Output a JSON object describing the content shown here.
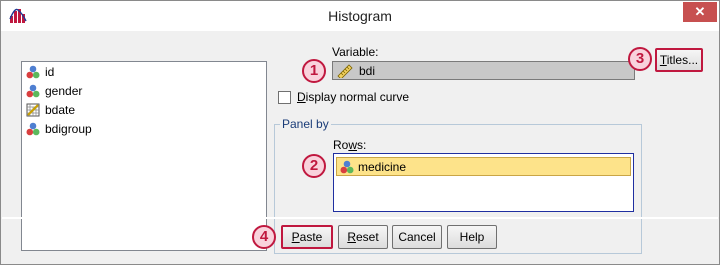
{
  "window": {
    "title": "Histogram",
    "close_glyph": "✕"
  },
  "variables": [
    {
      "name": "id",
      "icon": "nominal-icon"
    },
    {
      "name": "gender",
      "icon": "nominal-icon"
    },
    {
      "name": "bdate",
      "icon": "date-scale-icon"
    },
    {
      "name": "bdigroup",
      "icon": "nominal-icon"
    }
  ],
  "variable_field": {
    "label": "Variable:",
    "value": "bdi",
    "icon": "scale-ruler-icon"
  },
  "normal_curve": {
    "label_first": "D",
    "label_rest": "isplay normal curve",
    "checked": false
  },
  "panel_by": {
    "title": "Panel by",
    "rows_label_a": "Ro",
    "rows_label_u": "w",
    "rows_label_b": "s:",
    "rows_value": "medicine"
  },
  "badges": [
    "1",
    "2",
    "3",
    "4"
  ],
  "buttons": {
    "titles_u": "T",
    "titles_rest": "itles...",
    "paste_u": "P",
    "paste_rest": "aste",
    "reset_u": "R",
    "reset_rest": "eset",
    "cancel": "Cancel",
    "help": "Help"
  },
  "colors": {
    "badge_accent": "#c0183f",
    "selection": "#fde38a"
  }
}
